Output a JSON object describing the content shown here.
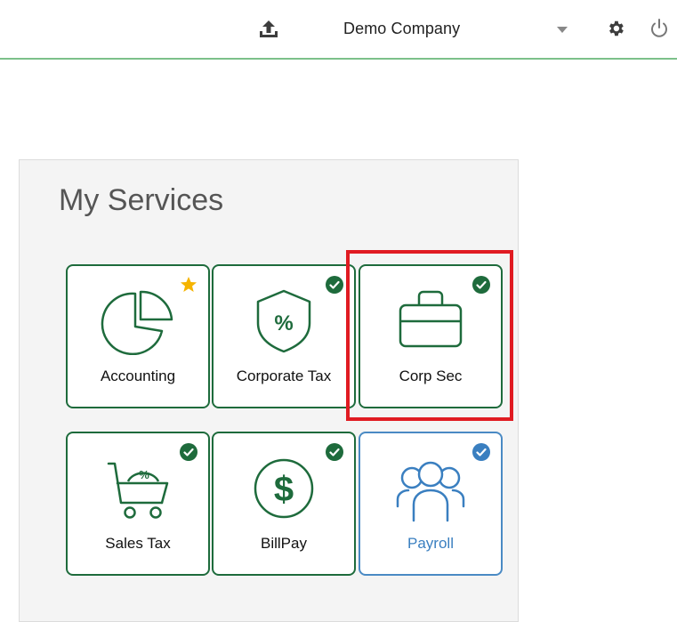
{
  "header": {
    "company_name": "Demo Company",
    "icons": [
      "upload-icon",
      "chevron-down-icon",
      "gear-icon",
      "power-icon"
    ],
    "accent_color": "#7cc08a"
  },
  "services": {
    "title": "My Services",
    "tiles": [
      {
        "label": "Accounting",
        "icon": "pie-chart-icon",
        "badge": "star-icon"
      },
      {
        "label": "Corporate Tax",
        "icon": "percent-shield-icon",
        "badge": "check-icon"
      },
      {
        "label": "Corp Sec",
        "icon": "briefcase-icon",
        "badge": "check-icon"
      },
      {
        "label": "Sales Tax",
        "icon": "shopping-cart-icon",
        "badge": "check-icon"
      },
      {
        "label": "BillPay",
        "icon": "dollar-icon",
        "badge": "check-icon"
      },
      {
        "label": "Payroll",
        "icon": "people-icon",
        "badge": "check-icon"
      }
    ],
    "colors": {
      "green": "#1e6b3c",
      "blue": "#3a7fc0",
      "star": "#f5b400",
      "highlight": "#e01b22"
    }
  }
}
